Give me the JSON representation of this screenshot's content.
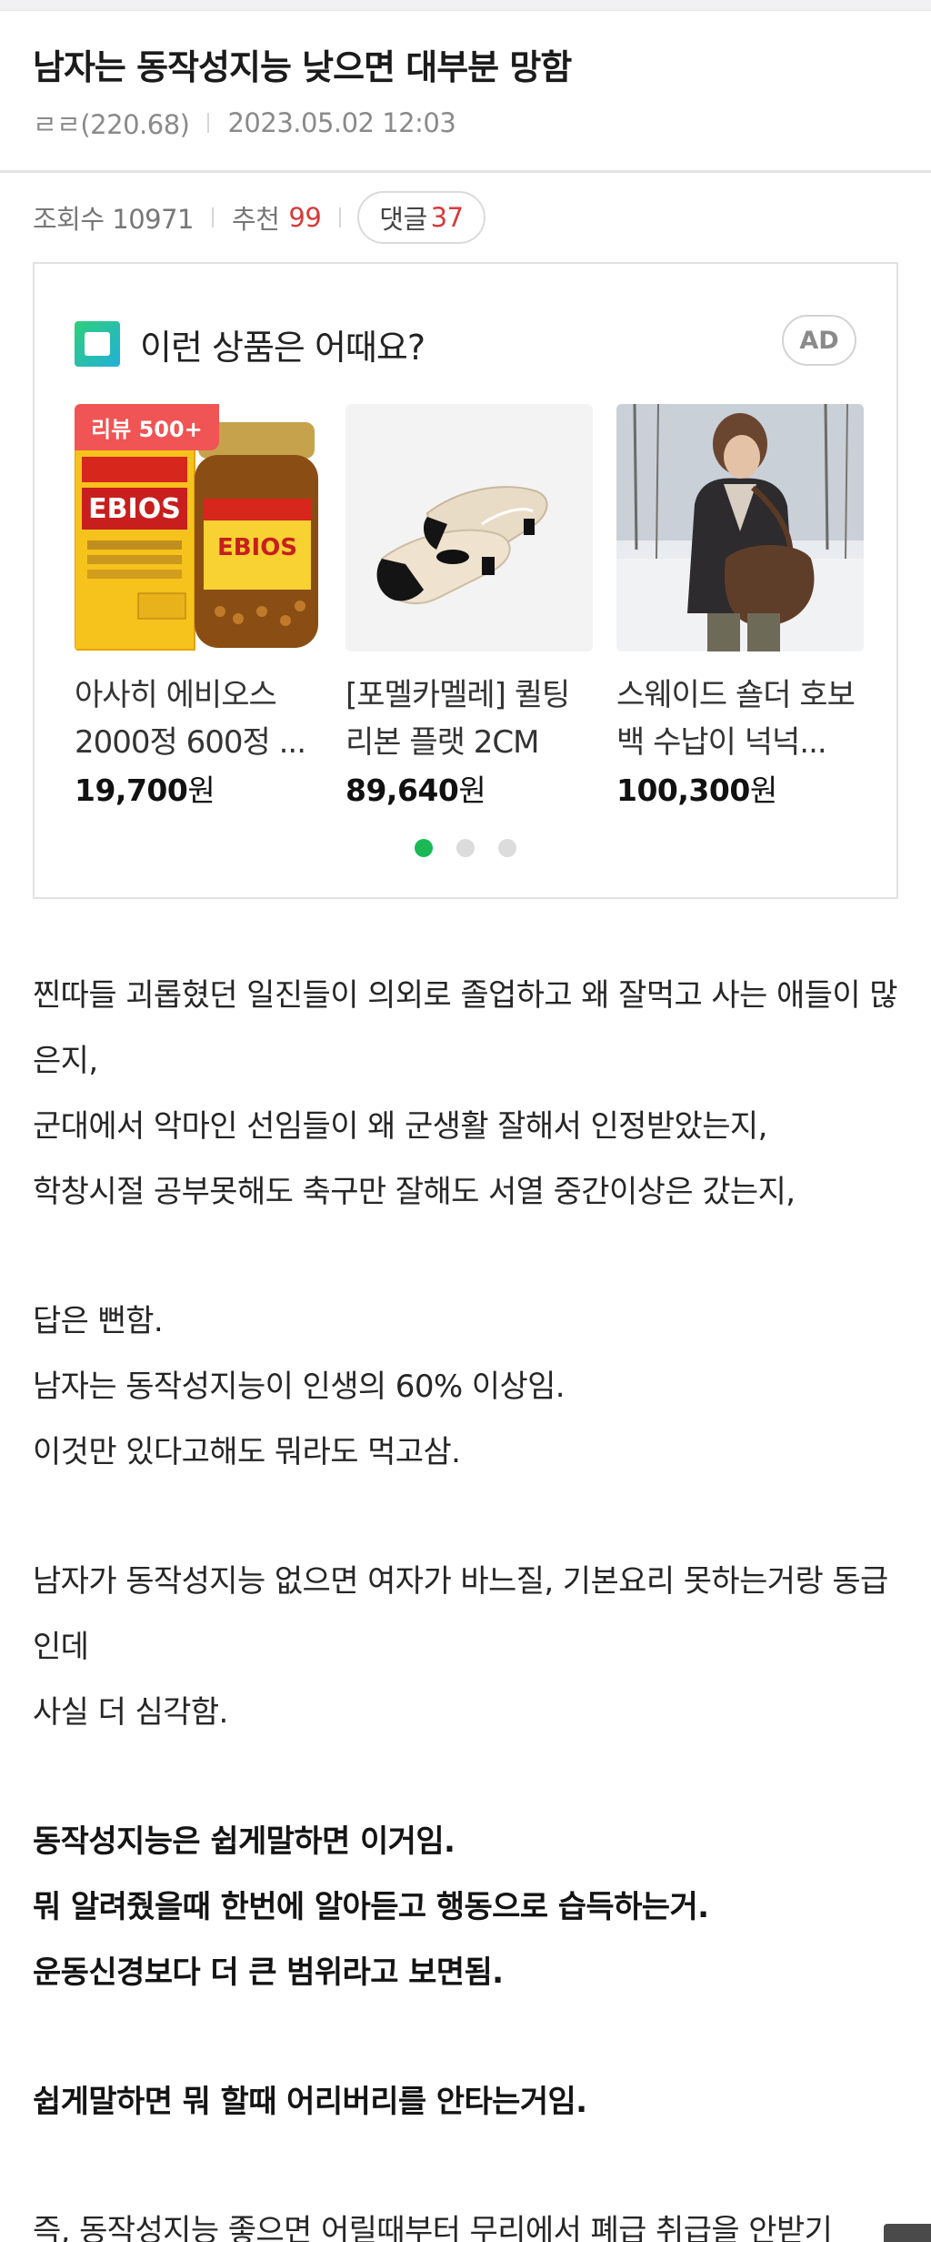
{
  "post": {
    "title": "남자는 동작성지능 낮으면 대부분 망함",
    "author": "ㄹㄹ(220.68)",
    "date": "2023.05.02 12:03"
  },
  "stats": {
    "views_label": "조회수 10971",
    "recommend_label": "추천",
    "recommend_count": "99",
    "comments_label": "댓글",
    "comments_count": "37"
  },
  "ad": {
    "title": "이런 상품은 어때요?",
    "badge": "AD",
    "review_badge": "리뷰 500+",
    "products": [
      {
        "name": "아사히 에비오스 2000정 600정 ...",
        "price": "19,700",
        "unit": "원",
        "image": "ebios-bottle-icon"
      },
      {
        "name": "[포멜카멜레] 퀼팅 리본 플랫 2CM",
        "price": "89,640",
        "unit": "원",
        "image": "flat-shoe-icon"
      },
      {
        "name": "스웨이드 숄더 호보백 수납이 넉넉...",
        "price": "100,300",
        "unit": "원",
        "image": "hobo-bag-icon"
      }
    ],
    "carousel": {
      "total": 3,
      "active": 1
    },
    "colors": {
      "active_dot": "#1bb954",
      "review_badge": "#f05454"
    }
  },
  "article": {
    "lines": [
      "찐따들 괴롭혔던 일진들이 의외로 졸업하고 왜 잘먹고 사는 애들이 많은지,",
      "군대에서 악마인 선임들이 왜 군생활 잘해서 인정받았는지,",
      "학창시절 공부못해도 축구만 잘해도 서열 중간이상은 갔는지,",
      "",
      "답은 뻔함.",
      "남자는 동작성지능이 인생의 60% 이상임.",
      "이것만 있다고해도 뭐라도 먹고삼.",
      "",
      "남자가 동작성지능 없으면 여자가 바느질, 기본요리 못하는거랑 동급인데",
      "사실 더 심각함.",
      "",
      "동작성지능은 쉽게말하면 이거임.",
      "뭐 알려줬을때 한번에 알아듣고 행동으로 습득하는거.",
      "운동신경보다 더 큰 범위라고 보면됨.",
      "",
      "쉽게말하면 뭐 할때 어리버리를 안타는거임.",
      "",
      "즉, 동작성지능 좋으면 어릴때부터 무리에서 폐급 취급을 안받기"
    ]
  }
}
